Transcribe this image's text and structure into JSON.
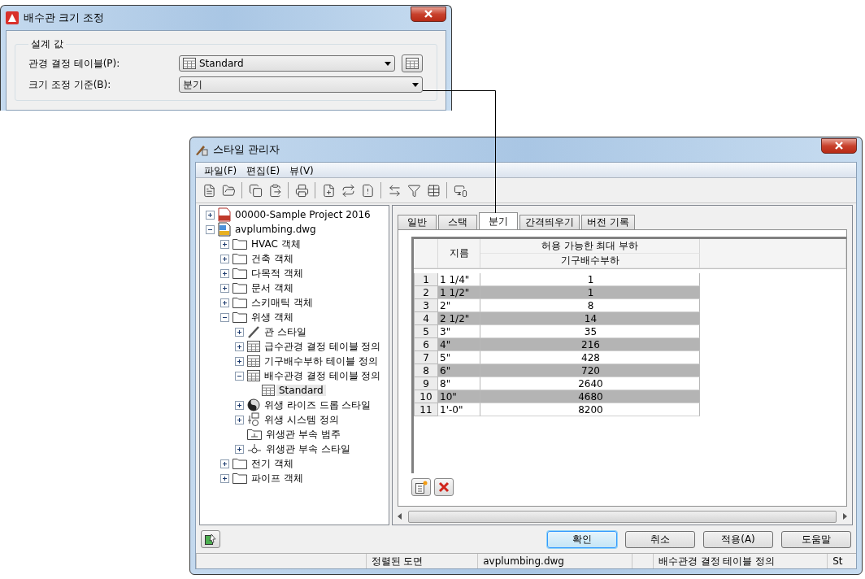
{
  "drain_dialog": {
    "title": "배수관 크기 조정",
    "group": "설계 값",
    "fields": [
      {
        "label": "관경 결정 테이블(P):",
        "value": "Standard",
        "kind": "table-combo"
      },
      {
        "label": "크기 조정 기준(B):",
        "value": "분기",
        "kind": "combo"
      }
    ]
  },
  "style_manager": {
    "title": "스타일 관리자",
    "menu": [
      "파일(F)",
      "편집(E)",
      "뷰(V)"
    ],
    "tree": [
      {
        "label": "00000-Sample Project 2016",
        "kind": "project",
        "expanded": false,
        "selected": false
      },
      {
        "label": "avplumbing.dwg",
        "kind": "drawing",
        "expanded": true,
        "selected": false,
        "children": [
          {
            "label": "HVAC 객체",
            "kind": "folder",
            "expanded": false,
            "selected": false
          },
          {
            "label": "건축 객체",
            "kind": "folder",
            "expanded": false,
            "selected": false
          },
          {
            "label": "다목적 객체",
            "kind": "folder",
            "expanded": false,
            "selected": false
          },
          {
            "label": "문서 객체",
            "kind": "folder",
            "expanded": false,
            "selected": false
          },
          {
            "label": "스키매틱 객체",
            "kind": "folder",
            "expanded": false,
            "selected": false
          },
          {
            "label": "위생 객체",
            "kind": "folder",
            "expanded": true,
            "selected": false,
            "children": [
              {
                "label": "관 스타일",
                "kind": "pipe",
                "expanded": false,
                "selected": false
              },
              {
                "label": "급수관경 결정 테이블 정의",
                "kind": "table",
                "expanded": false,
                "selected": false
              },
              {
                "label": "기구배수부하 테이블 정의",
                "kind": "table",
                "expanded": false,
                "selected": false
              },
              {
                "label": "배수관경 결정 테이블 정의",
                "kind": "table",
                "expanded": true,
                "selected": false,
                "children": [
                  {
                    "label": "Standard",
                    "kind": "table",
                    "selected": true
                  }
                ]
              },
              {
                "label": "위생 라이즈 드롭 스타일",
                "kind": "riser",
                "expanded": false,
                "selected": false
              },
              {
                "label": "위생 시스템 정의",
                "kind": "system",
                "expanded": false,
                "selected": false
              },
              {
                "label": "위생관 부속 범주",
                "kind": "category",
                "selected": false
              },
              {
                "label": "위생관 부속 스타일",
                "kind": "fitting",
                "expanded": false,
                "selected": false
              }
            ]
          },
          {
            "label": "전기 객체",
            "kind": "folder",
            "expanded": false,
            "selected": false
          },
          {
            "label": "파이프 객체",
            "kind": "folder",
            "expanded": false,
            "selected": false
          }
        ]
      }
    ],
    "tabs": [
      {
        "label": "일반",
        "selected": false
      },
      {
        "label": "스택",
        "selected": false
      },
      {
        "label": "분기",
        "selected": true
      },
      {
        "label": "간격띄우기",
        "selected": false
      },
      {
        "label": "버전 기록",
        "selected": false
      }
    ],
    "table": {
      "size_header": "지름",
      "group_header": "허용 가능한 최대 부하",
      "sub_header": "기구배수부하",
      "rows": [
        {
          "number": "1",
          "size": "1 1/4\"",
          "load": "1"
        },
        {
          "number": "2",
          "size": "1 1/2\"",
          "load": "1"
        },
        {
          "number": "3",
          "size": "2\"",
          "load": "8"
        },
        {
          "number": "4",
          "size": "2 1/2\"",
          "load": "14"
        },
        {
          "number": "5",
          "size": "3\"",
          "load": "35"
        },
        {
          "number": "6",
          "size": "4\"",
          "load": "216"
        },
        {
          "number": "7",
          "size": "5\"",
          "load": "428"
        },
        {
          "number": "8",
          "size": "6\"",
          "load": "720"
        },
        {
          "number": "9",
          "size": "8\"",
          "load": "2640"
        },
        {
          "number": "10",
          "size": "10\"",
          "load": "4680"
        },
        {
          "number": "11",
          "size": "1'-0\"",
          "load": "8200"
        }
      ]
    },
    "buttons": [
      {
        "label": "확인",
        "default": true
      },
      {
        "label": "취소",
        "default": false
      },
      {
        "label": "적용(A)",
        "default": false
      },
      {
        "label": "도움말",
        "default": false
      }
    ],
    "status_bar": [
      "정렬된 도면",
      "avplumbing.dwg",
      "배수관경 결정 테이블 정의",
      "St"
    ]
  }
}
